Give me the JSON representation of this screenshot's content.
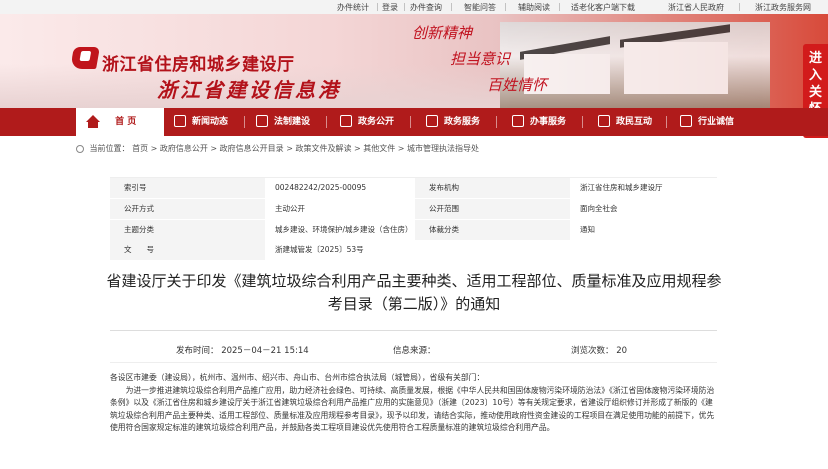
{
  "topbar": {
    "links": [
      "办件统计",
      "登录",
      "办件查询",
      "智能问答",
      "辅助阅读",
      "适老化客户端下载",
      "浙江省人民政府",
      "浙江政务服务网"
    ]
  },
  "header": {
    "site_title": "浙江省住房和城乡建设厅",
    "site_subtitle": "浙江省建设信息港",
    "slogans": [
      "创新精神",
      "担当意识",
      "百姓情怀"
    ]
  },
  "side_float": {
    "label": "进入关怀版"
  },
  "nav": {
    "items": [
      "首 页",
      "新闻动态",
      "法制建设",
      "政务公开",
      "政务服务",
      "办事服务",
      "政民互动",
      "行业诚信"
    ]
  },
  "breadcrumb": {
    "prefix": "当前位置：",
    "path": "首页 > 政府信息公开 > 政府信息公开目录 > 政策文件及解读 > 其他文件 > 城市管理执法指导处"
  },
  "meta": {
    "rows": [
      {
        "l1": "索引号",
        "v1": "002482242/2025-00095",
        "l2": "发布机构",
        "v2": "浙江省住房和城乡建设厅"
      },
      {
        "l1": "公开方式",
        "v1": "主动公开",
        "l2": "公开范围",
        "v2": "面向全社会"
      },
      {
        "l1": "主题分类",
        "v1": "城乡建设、环境保护/城乡建设（含住房）",
        "l2": "体裁分类",
        "v2": "通知"
      },
      {
        "l1": "文　　号",
        "v1": "浙建城管发〔2025〕53号",
        "l2": "",
        "v2": ""
      }
    ]
  },
  "article": {
    "title": "省建设厅关于印发《建筑垃圾综合利用产品主要种类、适用工程部位、质量标准及应用规程参考目录（第二版）》的通知",
    "publish_time": "发布时间： 2025－04－21 15:14",
    "source": "信息来源：",
    "views": "浏览次数： 20",
    "salutation": "各设区市建委（建设局），杭州市、温州市、绍兴市、舟山市、台州市综合执法局（城管局），省级有关部门：",
    "paragraph": "为进一步推进建筑垃圾综合利用产品推广应用，助力经济社会绿色、可持续、高质量发展，根据《中华人民共和国固体废物污染环境防治法》《浙江省固体废物污染环境防治条例》以及《浙江省住房和城乡建设厅关于浙江省建筑垃圾综合利用产品推广应用的实施意见》（浙建〔2023〕10号）等有关规定要求，省建设厅组织修订并形成了新版的《建筑垃圾综合利用产品主要种类、适用工程部位、质量标准及应用规程参考目录》，现予以印发，请结合实际，推动使用政府性资金建设的工程项目在满足使用功能的前提下，优先使用符合国家规定标准的建筑垃圾综合利用产品，并鼓励各类工程项目建设优先使用符合工程质量标准的建筑垃圾综合利用产品。"
  }
}
